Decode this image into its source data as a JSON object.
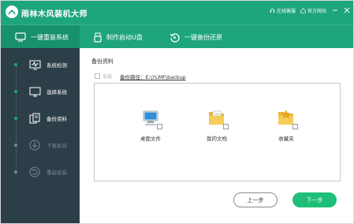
{
  "app": {
    "title": "雨林木风装机大师"
  },
  "titlebar": {
    "online_service": "在线客服",
    "official_site": "官方网站"
  },
  "colors": {
    "brand": "#1fa57d",
    "sidebar": "#2c3e48",
    "next_button": "#1fbf78"
  },
  "nav": [
    {
      "label": "一键重装系统",
      "icon": "monitor-icon"
    },
    {
      "label": "制作启动U盘",
      "icon": "usb-icon"
    },
    {
      "label": "一键备份还原",
      "icon": "restore-icon"
    }
  ],
  "steps": [
    {
      "label": "系统检测",
      "icon": "pulse-monitor-icon",
      "active": true
    },
    {
      "label": "选择系统",
      "icon": "desktop-icon",
      "active": true
    },
    {
      "label": "备份资料",
      "icon": "documents-icon",
      "active": true
    },
    {
      "label": "下载系统",
      "icon": "download-icon",
      "active": false
    },
    {
      "label": "重启安装",
      "icon": "restart-icon",
      "active": false
    }
  ],
  "main": {
    "title": "备份资料",
    "check_all": "全选",
    "path_label": "备份路径：",
    "path_value": "E:\\YLMF\\backup",
    "files": [
      {
        "label": "桌面文件",
        "icon": "desktop-computer-icon"
      },
      {
        "label": "我的文档",
        "icon": "documents-folder-icon"
      },
      {
        "label": "收藏夹",
        "icon": "favorites-folder-icon"
      }
    ],
    "prev_button": "上一步",
    "next_button": "下一步"
  }
}
